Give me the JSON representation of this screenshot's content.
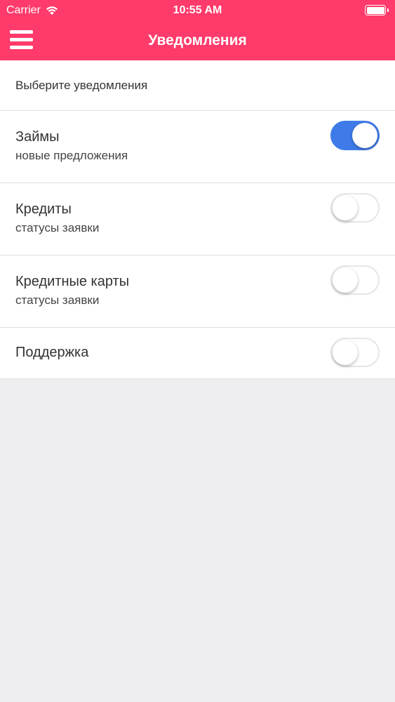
{
  "status_bar": {
    "carrier": "Carrier",
    "time": "10:55 AM",
    "wifi_icon": "wifi-icon",
    "battery_icon": "battery-icon",
    "battery_level": 1.0
  },
  "nav": {
    "title": "Уведомления",
    "menu_icon": "hamburger-menu-icon"
  },
  "section": {
    "header": "Выберите уведомления"
  },
  "settings": [
    {
      "title": "Займы",
      "subtitle": "новые предложения",
      "enabled": true
    },
    {
      "title": "Кредиты",
      "subtitle": "статусы заявки",
      "enabled": false
    },
    {
      "title": "Кредитные карты",
      "subtitle": "статусы заявки",
      "enabled": false
    },
    {
      "title": "Поддержка",
      "subtitle": "",
      "enabled": false
    }
  ],
  "colors": {
    "header_background": "#FF3B6B",
    "toggle_on": "#3F7BE8",
    "background": "#EEEEF0"
  }
}
